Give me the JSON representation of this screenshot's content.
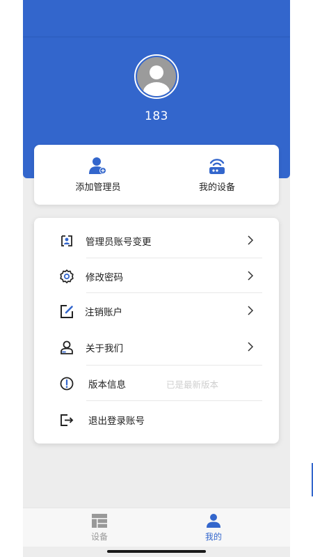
{
  "profile": {
    "username": "183"
  },
  "quick_actions": [
    {
      "label": "添加管理员",
      "icon": "add-admin-icon"
    },
    {
      "label": "我的设备",
      "icon": "router-icon"
    }
  ],
  "menu": {
    "items": [
      {
        "label": "管理员账号变更",
        "icon": "swap-admin-icon",
        "arrow": true
      },
      {
        "label": "修改密码",
        "icon": "gear-icon",
        "arrow": true
      },
      {
        "label": "注销账户",
        "icon": "edit-icon",
        "arrow": true
      },
      {
        "label": "关于我们",
        "icon": "person-icon",
        "arrow": true
      },
      {
        "label": "版本信息",
        "icon": "info-icon",
        "value": "已是最新版本"
      },
      {
        "label": "退出登录账号",
        "icon": "logout-icon"
      }
    ]
  },
  "tabbar": {
    "tabs": [
      {
        "label": "设备",
        "icon": "dashboard-icon",
        "active": false
      },
      {
        "label": "我的",
        "icon": "person-icon",
        "active": true
      }
    ]
  },
  "colors": {
    "brand": "#3366cc",
    "background": "#ededed",
    "inactive_tab": "#999999"
  }
}
